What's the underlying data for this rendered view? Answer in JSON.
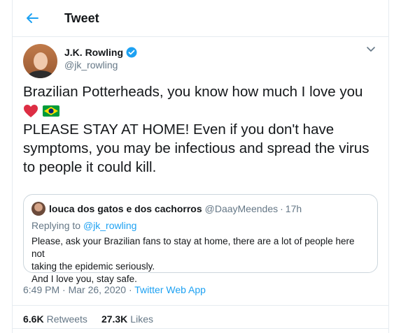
{
  "header": {
    "title": "Tweet"
  },
  "tweet": {
    "author_name": "J.K. Rowling",
    "author_handle": "@jk_rowling",
    "lines": [
      "Brazilian Potterheads, you know how much I love you",
      "PLEASE STAY AT HOME! Even if you don't have",
      "symptoms, you may be infectious and spread the virus",
      "to people it could kill."
    ],
    "emojis": [
      "heart-emoji",
      "brazil-flag-emoji"
    ],
    "timestamp": "6:49 PM · Mar 26, 2020 · ",
    "app": "Twitter Web App"
  },
  "quote": {
    "name": "louca dos gatos e dos cachorros",
    "handle": "@DaayMeendes",
    "separator": "·",
    "time": "17h",
    "replying_prefix": "Replying to ",
    "replying_to": "@jk_rowling",
    "lines": [
      "Please, ask your Brazilian fans to stay at home, there are a lot of people here not",
      "taking the epidemic seriously.",
      "And I love you, stay safe."
    ]
  },
  "stats": {
    "retweets_count": "6.6K",
    "retweets_label": "Retweets",
    "likes_count": "27.3K",
    "likes_label": "Likes"
  },
  "colors": {
    "accent": "#1da1f2",
    "text": "#14171a",
    "muted": "#657786",
    "border": "#e6ecf0"
  },
  "icons": {
    "back": "arrow-left-icon",
    "verified": "verified-badge-icon",
    "more": "chevron-down-icon"
  }
}
